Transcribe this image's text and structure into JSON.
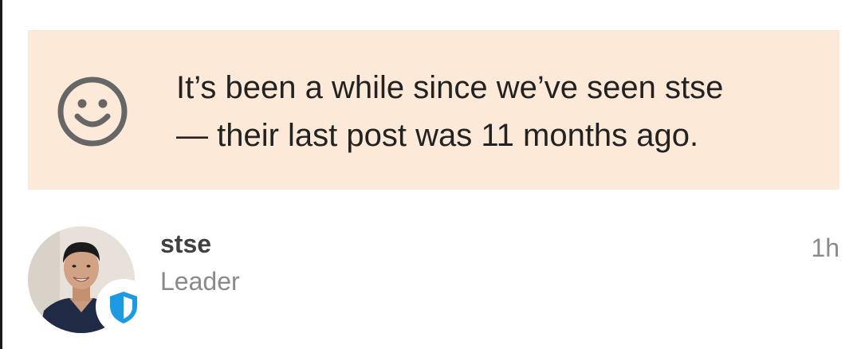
{
  "notice": {
    "icon": "smiley-icon",
    "line1": "It’s been a while since we’ve seen stse",
    "line2": "— their last post was 11 months ago.",
    "background_color": "#fde9d8"
  },
  "post": {
    "author": "stse",
    "role": "Leader",
    "time": "1h",
    "badge_icon": "shield-icon",
    "badge_color": "#1e9be0"
  }
}
